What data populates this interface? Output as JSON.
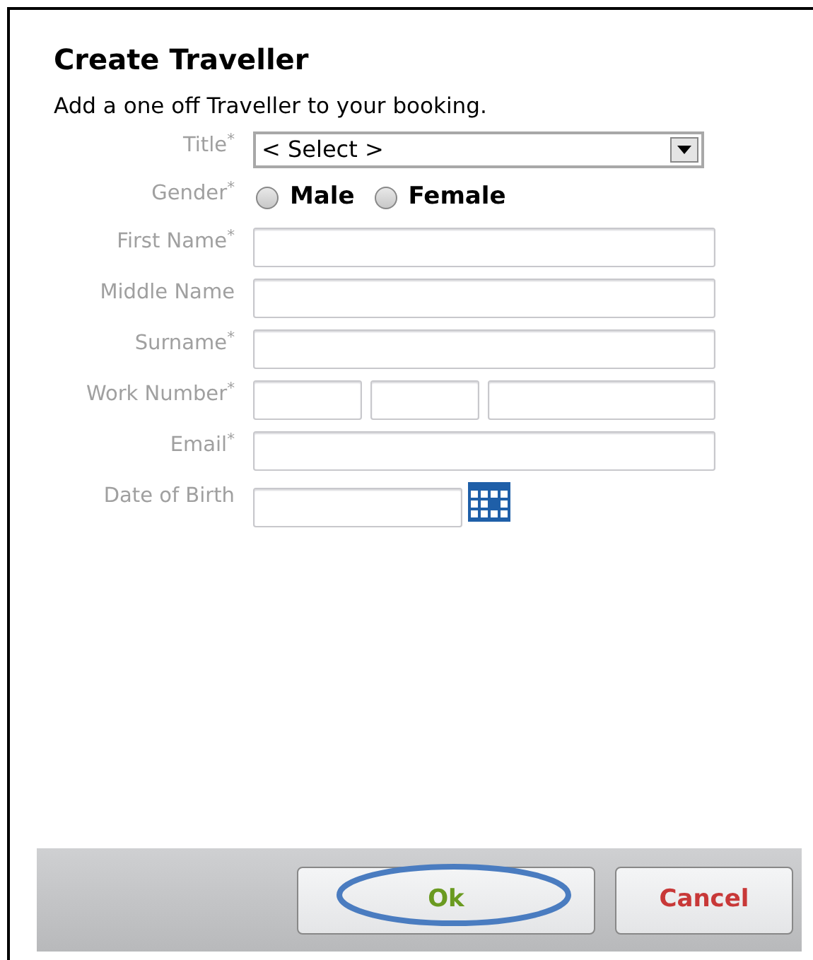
{
  "dialog": {
    "title": "Create Traveller",
    "description": "Add a one off Traveller to your booking.",
    "fields": [
      {
        "kind": "select",
        "label": "Title$^{*}$",
        "value": "< Select >"
      },
      {
        "kind": "radio",
        "label": "Gender$^{*}$",
        "options": [
          {
            "label": "Male",
            "selected": false
          },
          {
            "label": "Female",
            "selected": false
          }
        ]
      },
      {
        "kind": "text",
        "label": "First Name$^{*}$"
      },
      {
        "kind": "text",
        "label": "Middle Name"
      },
      {
        "kind": "text",
        "label": "Surname$^{*}$"
      },
      {
        "kind": "phone",
        "label": "Work Number$^{*}$"
      },
      {
        "kind": "text",
        "label": "Email$^{*}$"
      },
      {
        "kind": "date",
        "label": "Date of Birth"
      }
    ]
  },
  "buttons": [
    {
      "kind": "confirm",
      "label": "Ok",
      "highlighted": true
    },
    {
      "kind": "cancel",
      "label": "Cancel",
      "highlighted": false
    }
  ]
}
